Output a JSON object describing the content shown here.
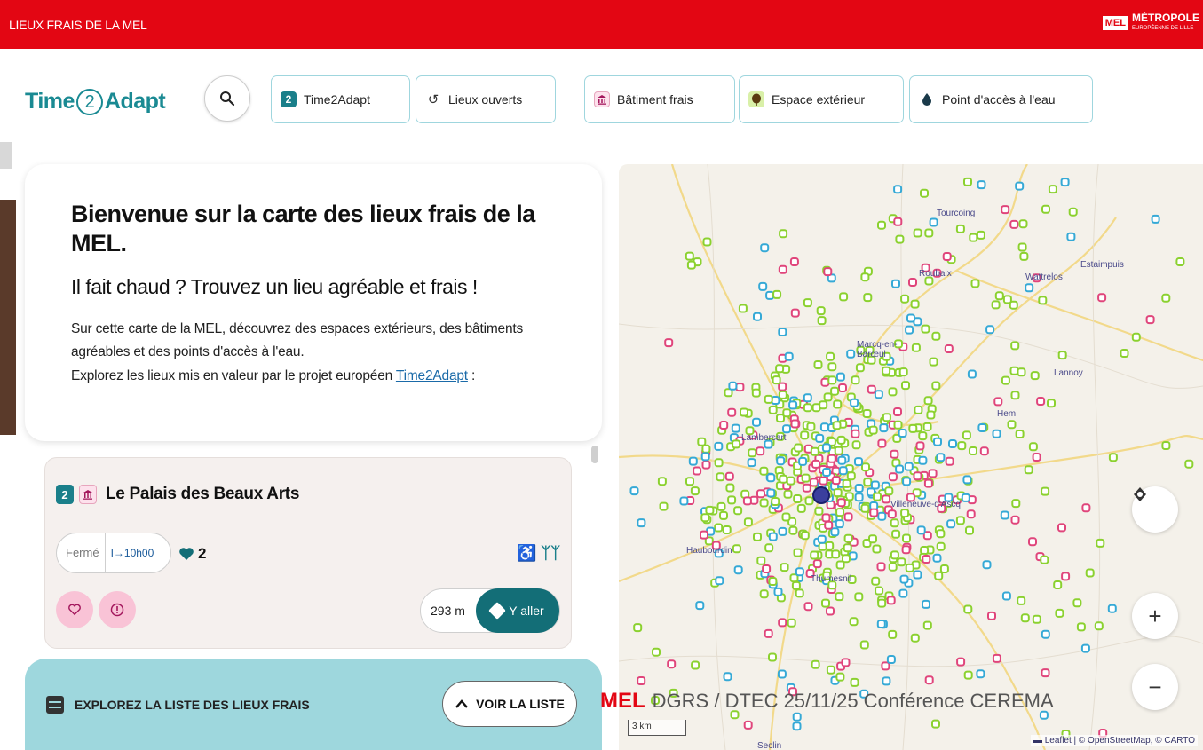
{
  "topbar": {
    "title": "LIEUX FRAIS DE LA MEL",
    "logo_box": "MEL",
    "logo_text": "MÉTROPOLE",
    "logo_sub": "EUROPÉENNE DE LILLE"
  },
  "nav": {
    "brand_left": "Time",
    "brand_mid": "2",
    "brand_right": "Adapt",
    "chips": [
      {
        "label": "Time2Adapt",
        "icon": "time2adapt-icon",
        "glyph": "2"
      },
      {
        "label": "Lieux ouverts",
        "icon": "history-icon",
        "glyph": "↺"
      },
      {
        "label": "Bâtiment frais",
        "icon": "building-icon",
        "glyph": "🏛"
      },
      {
        "label": "Espace extérieur",
        "icon": "tree-icon",
        "glyph": "♣"
      },
      {
        "label": "Point d'accès à l'eau",
        "icon": "water-drop-icon",
        "glyph": "●"
      }
    ]
  },
  "welcome": {
    "title": "Bienvenue sur la carte des lieux frais de la MEL.",
    "subtitle": "Il fait chaud ? Trouvez un lieu agréable et frais !",
    "text1": "Sur cette carte de la MEL, découvrez des espaces extérieurs, des bâtiments agréables et des points d'accès à l'eau.",
    "text2_pre": "Explorez les lieux mis en valeur par le projet européen ",
    "text2_link": "Time2Adapt",
    "text2_post": " :"
  },
  "card": {
    "tag": "2",
    "name": "Le Palais des Beaux Arts",
    "status": "Fermé",
    "opens": "I→10h00",
    "likes": "2",
    "distance": "293 m",
    "go_label": "Y aller"
  },
  "explore": {
    "label": "EXPLOREZ LA LISTE DES LIEUX FRAIS",
    "button": "VOIR LA LISTE"
  },
  "map": {
    "places": [
      {
        "name": "Tourcoing"
      },
      {
        "name": "Roubaix"
      },
      {
        "name": "Wattrelos"
      },
      {
        "name": "Estaimpuis"
      },
      {
        "name": "Marcq-en-Barœul"
      },
      {
        "name": "Lannoy"
      },
      {
        "name": "Lambersart"
      },
      {
        "name": "Hem"
      },
      {
        "name": "Haubourdin"
      },
      {
        "name": "Villeneuve-d'Ascq"
      },
      {
        "name": "Thumesnil"
      },
      {
        "name": "Seclin"
      }
    ],
    "scale": "3 km",
    "attribution": "▬ Leaflet | © OpenStreetMap, © CARTO",
    "zoom_in": "+",
    "zoom_out": "−"
  },
  "footer": {
    "brand": "MEL",
    "text": "DGRS / DTEC 25/11/25 Conférence CEREMA"
  },
  "colors": {
    "brand_red": "#e30613",
    "teal": "#136e77",
    "outdoor_green": "#8bd12f",
    "building_pink": "#e0457b",
    "water_blue": "#35a9d6"
  }
}
